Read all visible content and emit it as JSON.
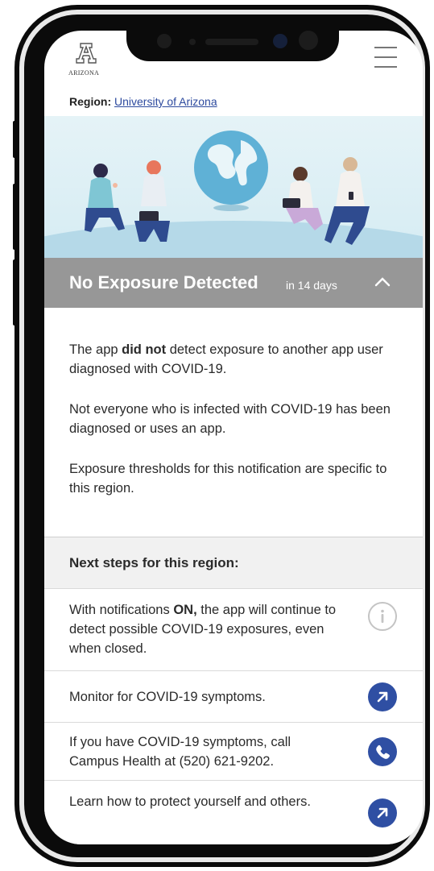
{
  "header": {
    "logo_text": "ARIZONA",
    "menu_icon": "hamburger-menu-icon"
  },
  "region": {
    "label": "Region:",
    "value": "University of Arizona"
  },
  "status": {
    "title": "No Exposure Detected",
    "subtitle": "in 14 days",
    "toggle_icon": "chevron-up-icon"
  },
  "details": {
    "p1_prefix": "The app ",
    "p1_bold": "did not",
    "p1_suffix": " detect exposure to another app user diagnosed with COVID-19.",
    "p2": "Not everyone who is infected with COVID-19 has been diagnosed or uses an app.",
    "p3": "Exposure thresholds for this notification are specific to this region."
  },
  "next_steps": {
    "title": "Next steps for this region:",
    "items": [
      {
        "prefix": "With notifications ",
        "bold": "ON,",
        "suffix": " the app will continue to detect possible COVID-19 exposures, even when closed.",
        "icon": "info-icon"
      },
      {
        "text": "Monitor for COVID-19 symptoms.",
        "icon": "arrow-up-right-icon"
      },
      {
        "text": "If you have COVID-19 symptoms, call Campus Health at (520) 621-9202.",
        "icon": "phone-icon"
      },
      {
        "text": "Learn how to protect yourself and others.",
        "icon": "arrow-up-right-icon"
      }
    ]
  },
  "colors": {
    "accent": "#2f4fa3",
    "status_bar": "#979797",
    "link": "#2d4a9e"
  }
}
